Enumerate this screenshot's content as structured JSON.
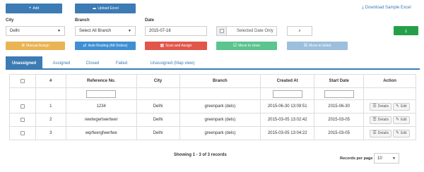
{
  "toolbar": {
    "add_label": "Add",
    "upload_label": "Upload Excel",
    "download_label": "Download Sample Excel",
    "download_button_icon": "download-icon"
  },
  "filters": {
    "city_label": "City",
    "city_value": "Delhi",
    "branch_label": "Branch",
    "branch_value": "Select All Branch",
    "date_label": "Date",
    "date_value": "2015-07-16",
    "selected_date_only": "Selected Date Only"
  },
  "actions": {
    "manual_assign": "Manual Assign",
    "auto_routing": "Auto Routing (All Orders)",
    "scan_assign": "Scan and Assign",
    "move_close": "Move to close",
    "move_failed": "Move to failed"
  },
  "tabs": [
    "Unassigned",
    "Assigned",
    "Closed",
    "Failed",
    "Unassigned (Map view)"
  ],
  "table": {
    "headers": [
      "",
      "#",
      "Reference No.",
      "City",
      "Branch",
      "Created At",
      "Start Date",
      "Action"
    ],
    "rows": [
      {
        "num": "1",
        "ref": "1234",
        "city": "Delhi",
        "branch": "greenpark (dels)",
        "created": "2015-06-30 13:09:51",
        "start": "2015-06-30"
      },
      {
        "num": "2",
        "ref": "rewtwgertwertwer",
        "city": "Delhi",
        "branch": "greenpark (dels)",
        "created": "2015-03-05 13:02:42",
        "start": "2015-03-05"
      },
      {
        "num": "3",
        "ref": "wqrfwergfwerfwe",
        "city": "Delhi",
        "branch": "greenpark (dels)",
        "created": "2015-03-05 13:04:22",
        "start": "2015-03-05"
      }
    ],
    "details_label": "Details",
    "edit_label": "Edit"
  },
  "footer": {
    "showing": "Showing 1 - 3 of 3 records",
    "per_page_label": "Records per page",
    "per_page_value": "10"
  },
  "colors": {
    "primary": "#3c7bb4",
    "warning": "#e9b454",
    "danger": "#e0574a",
    "success": "#5cc48f",
    "download": "#25a049"
  }
}
